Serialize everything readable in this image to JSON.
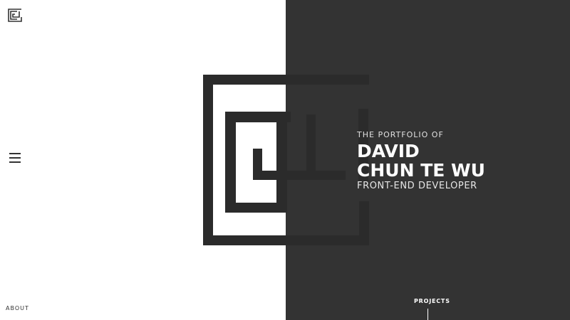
{
  "brand": {
    "logo_icon": "maze-logo-icon",
    "dark_color": "#333333",
    "light_color": "#ffffff",
    "logo_color": "#2b2b2b"
  },
  "nav": {
    "menu_icon": "hamburger-menu-icon",
    "about_label": "ABOUT",
    "projects_label": "PROJECTS"
  },
  "hero": {
    "pre_title": "THE PORTFOLIO OF",
    "name_line1": "DAVID",
    "name_line2": "CHUN TE WU",
    "role": "FRONT-END DEVELOPER"
  }
}
